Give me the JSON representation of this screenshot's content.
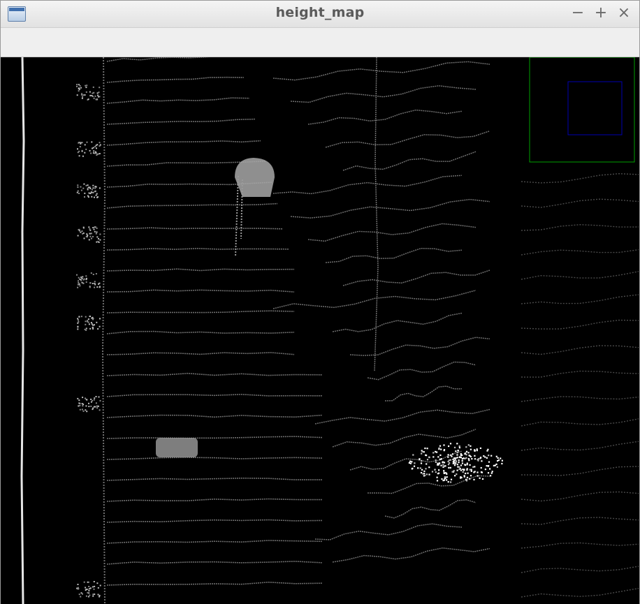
{
  "window": {
    "title": "height_map",
    "controls": {
      "minimize": "−",
      "maximize": "+",
      "close": "×"
    }
  },
  "colors": {
    "background": "#000000",
    "scan_lines": "#6e6e6e",
    "objects": "#bdbdbd",
    "bright_points": "#ffffff",
    "inset_outer_border": "#00a000",
    "inset_inner_border": "#0000b0"
  }
}
